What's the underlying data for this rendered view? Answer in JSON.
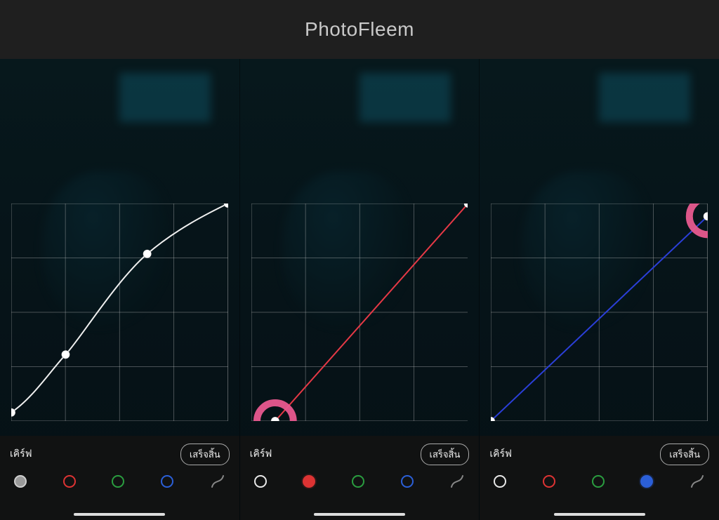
{
  "header": {
    "title": "PhotoFleem"
  },
  "labels": {
    "curve": "เคิร์ฟ",
    "done": "เสร็จสิ้น"
  },
  "channels": {
    "white": "white-channel",
    "red": "red-channel",
    "green": "green-channel",
    "blue": "blue-channel",
    "reset": "reset-curve"
  },
  "panels": [
    {
      "id": "panel-white",
      "active_channel": "white",
      "curve_color": "white",
      "highlight": null
    },
    {
      "id": "panel-red",
      "active_channel": "red",
      "curve_color": "red",
      "highlight": "bottom-left"
    },
    {
      "id": "panel-blue",
      "active_channel": "blue",
      "curve_color": "blue",
      "highlight": "top-right"
    }
  ],
  "chart_data": [
    {
      "type": "line",
      "title": "Luminance curve (white channel)",
      "xlabel": "",
      "ylabel": "",
      "xlim": [
        0,
        255
      ],
      "ylim": [
        0,
        255
      ],
      "series": [
        {
          "name": "white",
          "points": [
            {
              "x": 0,
              "y": 10
            },
            {
              "x": 64,
              "y": 78
            },
            {
              "x": 160,
              "y": 196
            },
            {
              "x": 255,
              "y": 255
            }
          ]
        }
      ]
    },
    {
      "type": "line",
      "title": "Red channel curve",
      "xlabel": "",
      "ylabel": "",
      "xlim": [
        0,
        255
      ],
      "ylim": [
        0,
        255
      ],
      "series": [
        {
          "name": "red",
          "points": [
            {
              "x": 28,
              "y": 0
            },
            {
              "x": 255,
              "y": 255
            }
          ]
        }
      ]
    },
    {
      "type": "line",
      "title": "Blue channel curve",
      "xlabel": "",
      "ylabel": "",
      "xlim": [
        0,
        255
      ],
      "ylim": [
        0,
        255
      ],
      "series": [
        {
          "name": "blue",
          "points": [
            {
              "x": 0,
              "y": 0
            },
            {
              "x": 255,
              "y": 240
            }
          ]
        }
      ]
    }
  ]
}
